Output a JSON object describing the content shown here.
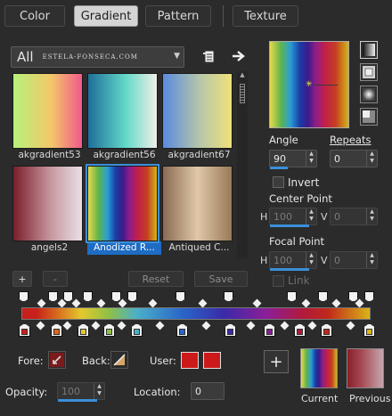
{
  "tabs": [
    "Color",
    "Gradient",
    "Pattern",
    "Texture"
  ],
  "active_tab": "Gradient",
  "library": {
    "category": "All",
    "watermark": "ESTELA-FONSECA.COM",
    "items": [
      {
        "label": "akgradient53",
        "colors": [
          "#b6f27a",
          "#f4c76a",
          "#f05a8a"
        ]
      },
      {
        "label": "akgradient56",
        "colors": [
          "#1e6f9a",
          "#64d9c8",
          "#f0f0e8"
        ]
      },
      {
        "label": "akgradient67",
        "colors": [
          "#5a8ae0",
          "#b8c8a8",
          "#f0e07a"
        ]
      },
      {
        "label": "angels2",
        "colors": [
          "#7a1e2a",
          "#c898a0",
          "#e8e0e8"
        ]
      },
      {
        "label": "Anodized R...",
        "colors": [
          "#e8d94a",
          "#2a9fd6",
          "#1a3da6",
          "#8a1e8a",
          "#c21e4a",
          "#d4b418"
        ]
      },
      {
        "label": "Antiqued C...",
        "colors": [
          "#8a6a52",
          "#e0c8a8",
          "#9a7a58"
        ]
      }
    ],
    "selected_index": 4
  },
  "editor_buttons": {
    "add": "+",
    "remove": "-",
    "reset": "Reset",
    "save": "Save"
  },
  "angle": {
    "label": "Angle",
    "value": "90"
  },
  "repeats": {
    "label": "Repeats",
    "value": "0"
  },
  "invert": {
    "label": "Invert"
  },
  "center_point": {
    "label": "Center Point",
    "h_label": "H",
    "h": "100",
    "v_label": "V",
    "v": "0"
  },
  "focal_point": {
    "label": "Focal Point",
    "h_label": "H",
    "h": "100",
    "v_label": "V",
    "v": "0"
  },
  "link": {
    "label": "Link"
  },
  "color_stops": [
    "#c8201a",
    "#d86a1c",
    "#e3c92e",
    "#8ec045",
    "#4ab0c8",
    "#2a66c8",
    "#3a2aa8",
    "#8a1e9a",
    "#b21a3a",
    "#c0281a",
    "#dbb418"
  ],
  "bottom": {
    "fore_label": "Fore:",
    "back_label": "Back:",
    "user_label": "User:",
    "opacity_label": "Opacity:",
    "opacity_value": "100",
    "location_label": "Location:",
    "location_value": "0",
    "current_label": "Current",
    "previous_label": "Previous",
    "add_symbol": "+"
  },
  "colors": {
    "accent": "#3b8fd9",
    "selection": "#1e6cc4",
    "user_color": "#cc1a1a"
  }
}
